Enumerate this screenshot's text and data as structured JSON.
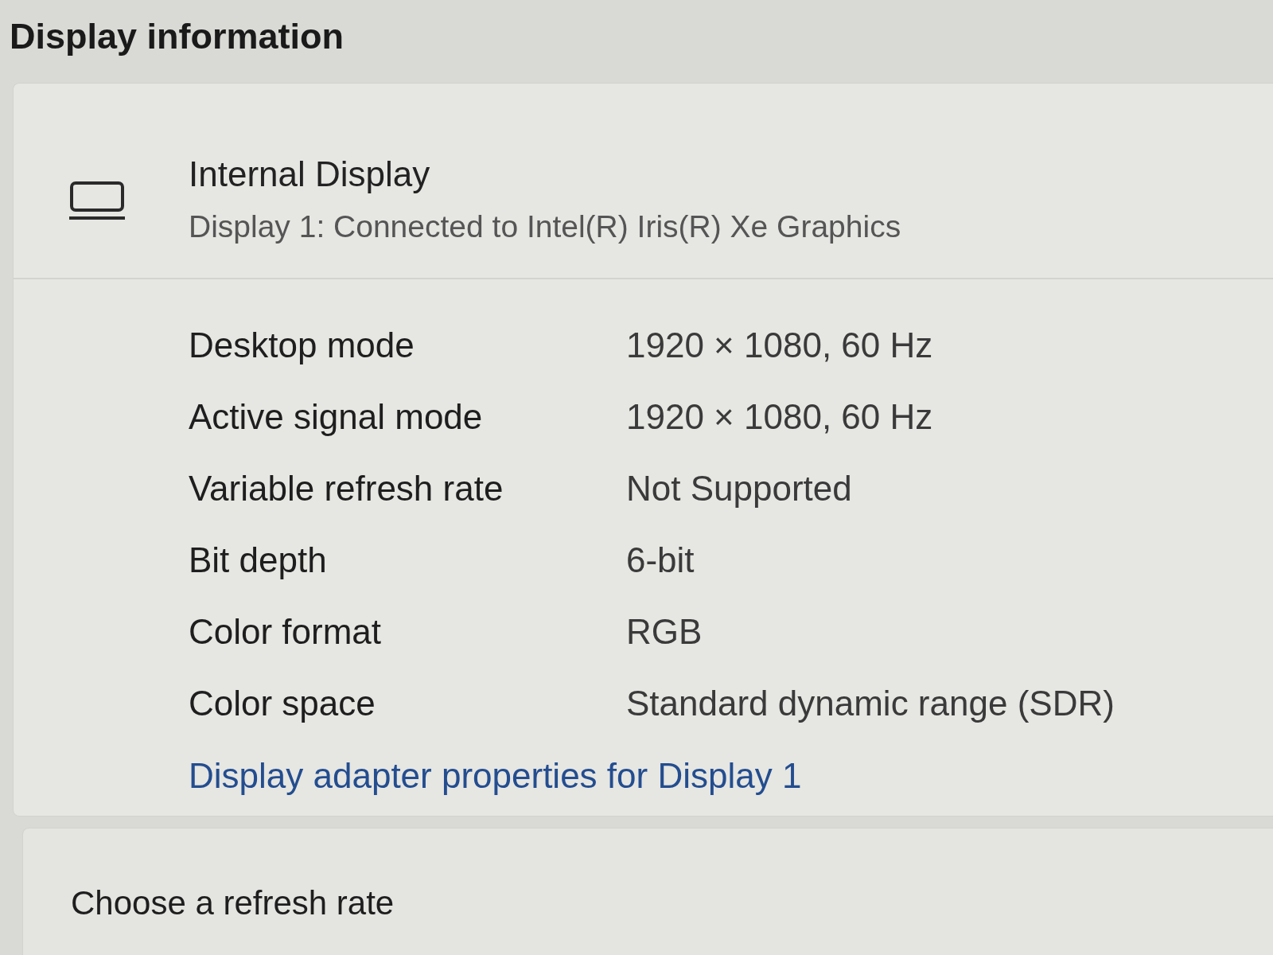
{
  "section_title": "Display information",
  "display": {
    "name": "Internal Display",
    "description": "Display 1: Connected to Intel(R) Iris(R) Xe Graphics"
  },
  "properties": [
    {
      "label": "Desktop mode",
      "value": "1920 × 1080, 60 Hz"
    },
    {
      "label": "Active signal mode",
      "value": "1920 × 1080, 60 Hz"
    },
    {
      "label": "Variable refresh rate",
      "value": "Not Supported"
    },
    {
      "label": "Bit depth",
      "value": "6-bit"
    },
    {
      "label": "Color format",
      "value": "RGB"
    },
    {
      "label": "Color space",
      "value": "Standard dynamic range (SDR)"
    }
  ],
  "link": "Display adapter properties for Display 1",
  "next_setting": {
    "title": "Choose a refresh rate"
  }
}
